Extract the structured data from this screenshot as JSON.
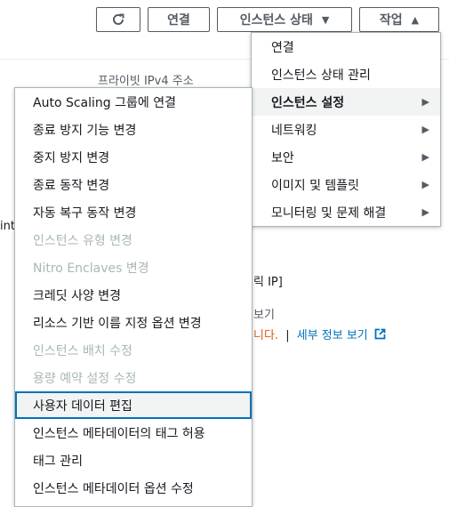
{
  "toolbar": {
    "refresh_icon": "refresh-icon",
    "connect_label": "연결",
    "instance_state_label": "인스턴스 상태",
    "actions_label": "작업"
  },
  "background": {
    "private_ipv4_label": "프라이빗 IPv4 주소",
    "partial_left": "int",
    "partial_ip": "릭 IP]",
    "partial_text": "보기",
    "partial_message": "니다.",
    "separator": "|",
    "details_link": "세부 정보 보기",
    "external_icon": "external-link-icon"
  },
  "actions_menu": {
    "items": [
      {
        "label": "연결",
        "has_submenu": false
      },
      {
        "label": "인스턴스 상태 관리",
        "has_submenu": false
      },
      {
        "label": "인스턴스 설정",
        "has_submenu": true,
        "active": true
      },
      {
        "label": "네트워킹",
        "has_submenu": true
      },
      {
        "label": "보안",
        "has_submenu": true
      },
      {
        "label": "이미지 및 템플릿",
        "has_submenu": true
      },
      {
        "label": "모니터링 및 문제 해결",
        "has_submenu": true
      }
    ]
  },
  "instance_settings_menu": {
    "items": [
      {
        "label": "Auto Scaling 그룹에 연결",
        "enabled": true
      },
      {
        "label": "종료 방지 기능 변경",
        "enabled": true
      },
      {
        "label": "중지 방지 변경",
        "enabled": true
      },
      {
        "label": "종료 동작 변경",
        "enabled": true
      },
      {
        "label": "자동 복구 동작 변경",
        "enabled": true
      },
      {
        "label": "인스턴스 유형 변경",
        "enabled": false
      },
      {
        "label": "Nitro Enclaves 변경",
        "enabled": false
      },
      {
        "label": "크레딧 사양 변경",
        "enabled": true
      },
      {
        "label": "리소스 기반 이름 지정 옵션 변경",
        "enabled": true
      },
      {
        "label": "인스턴스 배치 수정",
        "enabled": false
      },
      {
        "label": "용량 예약 설정 수정",
        "enabled": false
      },
      {
        "label": "사용자 데이터 편집",
        "enabled": true,
        "focused": true
      },
      {
        "label": "인스턴스 메타데이터의 태그 허용",
        "enabled": true
      },
      {
        "label": "태그 관리",
        "enabled": true
      },
      {
        "label": "인스턴스 메타데이터 옵션 수정",
        "enabled": true
      }
    ]
  },
  "colors": {
    "link": "#0073bb",
    "warning": "#d45b07",
    "disabled": "#aab7b8",
    "border": "#545b64"
  }
}
